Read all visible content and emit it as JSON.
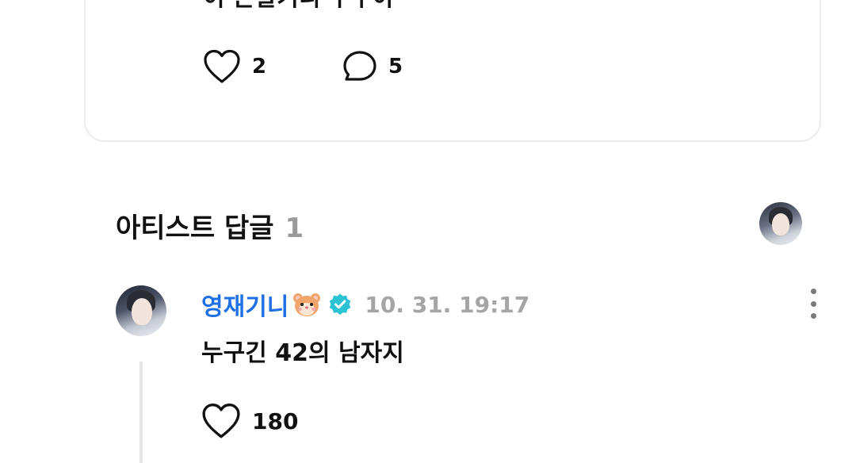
{
  "post": {
    "text": "이 존잘기니 누구야",
    "like_count": "2",
    "reply_count": "5"
  },
  "artist_replies": {
    "title": "아티스트 답글",
    "count": "1"
  },
  "comment": {
    "author": "영재기니",
    "date": "10. 31. 19:17",
    "text": "누구긴 42의 남자지",
    "like_count": "180"
  },
  "colors": {
    "author_name": "#1f6fe5",
    "verified_badge": "#2bc3d4",
    "muted_text": "#a5a5a5",
    "card_border": "#ebebeb"
  },
  "icons": {
    "post_like": "heart-outline-icon",
    "post_reply": "speech-bubble-icon",
    "author_emoji": "hamster-icon",
    "author_badge": "verified-check-icon",
    "comment_menu": "more-vertical-icon",
    "comment_like": "heart-outline-icon"
  }
}
